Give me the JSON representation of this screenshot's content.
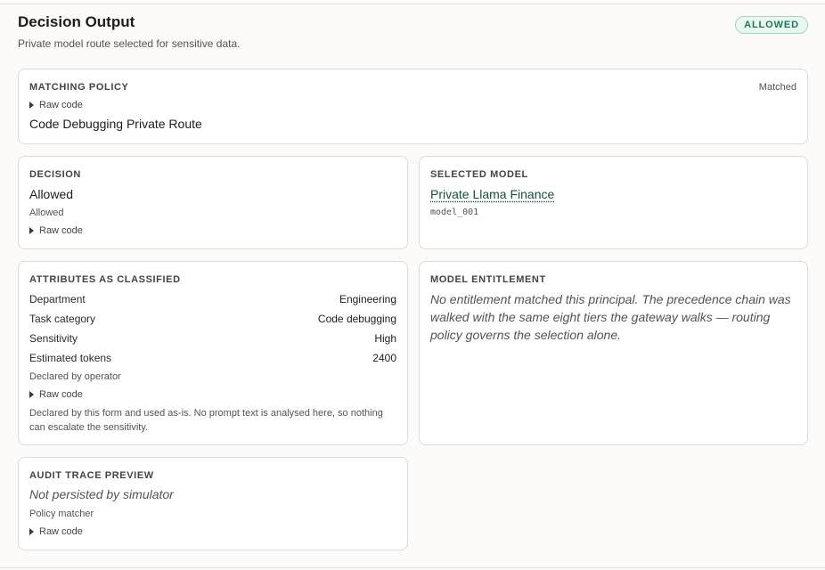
{
  "header": {
    "title": "Decision Output",
    "subtitle": "Private model route selected for sensitive data.",
    "status": "ALLOWED",
    "status_color": "#1f7a52"
  },
  "matching_policy": {
    "label": "MATCHING POLICY",
    "state": "Matched",
    "raw_toggle": "Raw code",
    "policy_name": "Code Debugging Private Route"
  },
  "decision": {
    "label": "DECISION",
    "value": "Allowed",
    "detail": "Allowed",
    "raw_toggle": "Raw code"
  },
  "selected_model": {
    "label": "SELECTED MODEL",
    "model_name": "Private Llama Finance",
    "model_id": "model_001"
  },
  "attributes": {
    "label": "ATTRIBUTES AS CLASSIFIED",
    "rows": [
      {
        "key": "Department",
        "value": "Engineering"
      },
      {
        "key": "Task category",
        "value": "Code debugging"
      },
      {
        "key": "Sensitivity",
        "value": "High"
      },
      {
        "key": "Estimated tokens",
        "value": "2400"
      }
    ],
    "source": "Declared by operator",
    "raw_toggle": "Raw code",
    "footnote": "Declared by this form and used as-is. No prompt text is analysed here, so nothing can escalate the sensitivity."
  },
  "entitlement": {
    "label": "MODEL ENTITLEMENT",
    "message": "No entitlement matched this principal. The precedence chain was walked with the same eight tiers the gateway walks — routing policy governs the selection alone."
  },
  "audit": {
    "label": "AUDIT TRACE PREVIEW",
    "value": "Not persisted by simulator",
    "source": "Policy matcher",
    "raw_toggle": "Raw code"
  }
}
